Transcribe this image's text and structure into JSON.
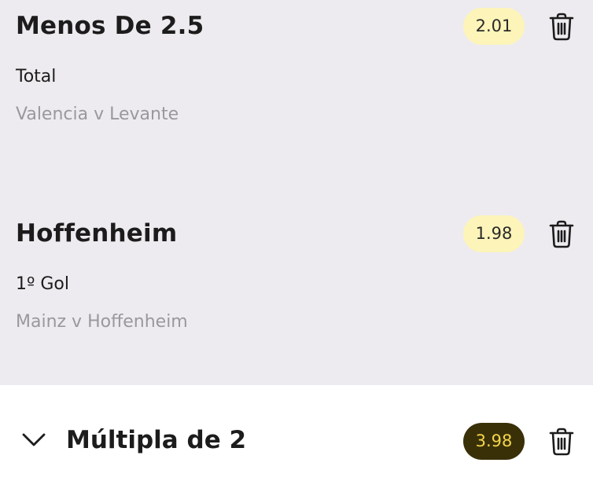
{
  "colors": {
    "selections_background": "#edebef",
    "odds_pill_background": "#fdf4b9",
    "multi_pill_background": "#3a3008",
    "multi_pill_text": "#f3d64a",
    "secondary_text": "#9a989c"
  },
  "selections": [
    {
      "title": "Menos De 2.5",
      "market": "Total",
      "event": "Valencia v Levante",
      "odds": "2.01",
      "remove_icon": "trash-icon"
    },
    {
      "title": "Hoffenheim",
      "market": "1º Gol",
      "event": "Mainz v Hoffenheim",
      "odds": "1.98",
      "remove_icon": "trash-icon"
    }
  ],
  "multiple": {
    "expand_icon": "chevron-down-icon",
    "title": "Múltipla de 2",
    "odds": "3.98",
    "remove_icon": "trash-icon"
  }
}
